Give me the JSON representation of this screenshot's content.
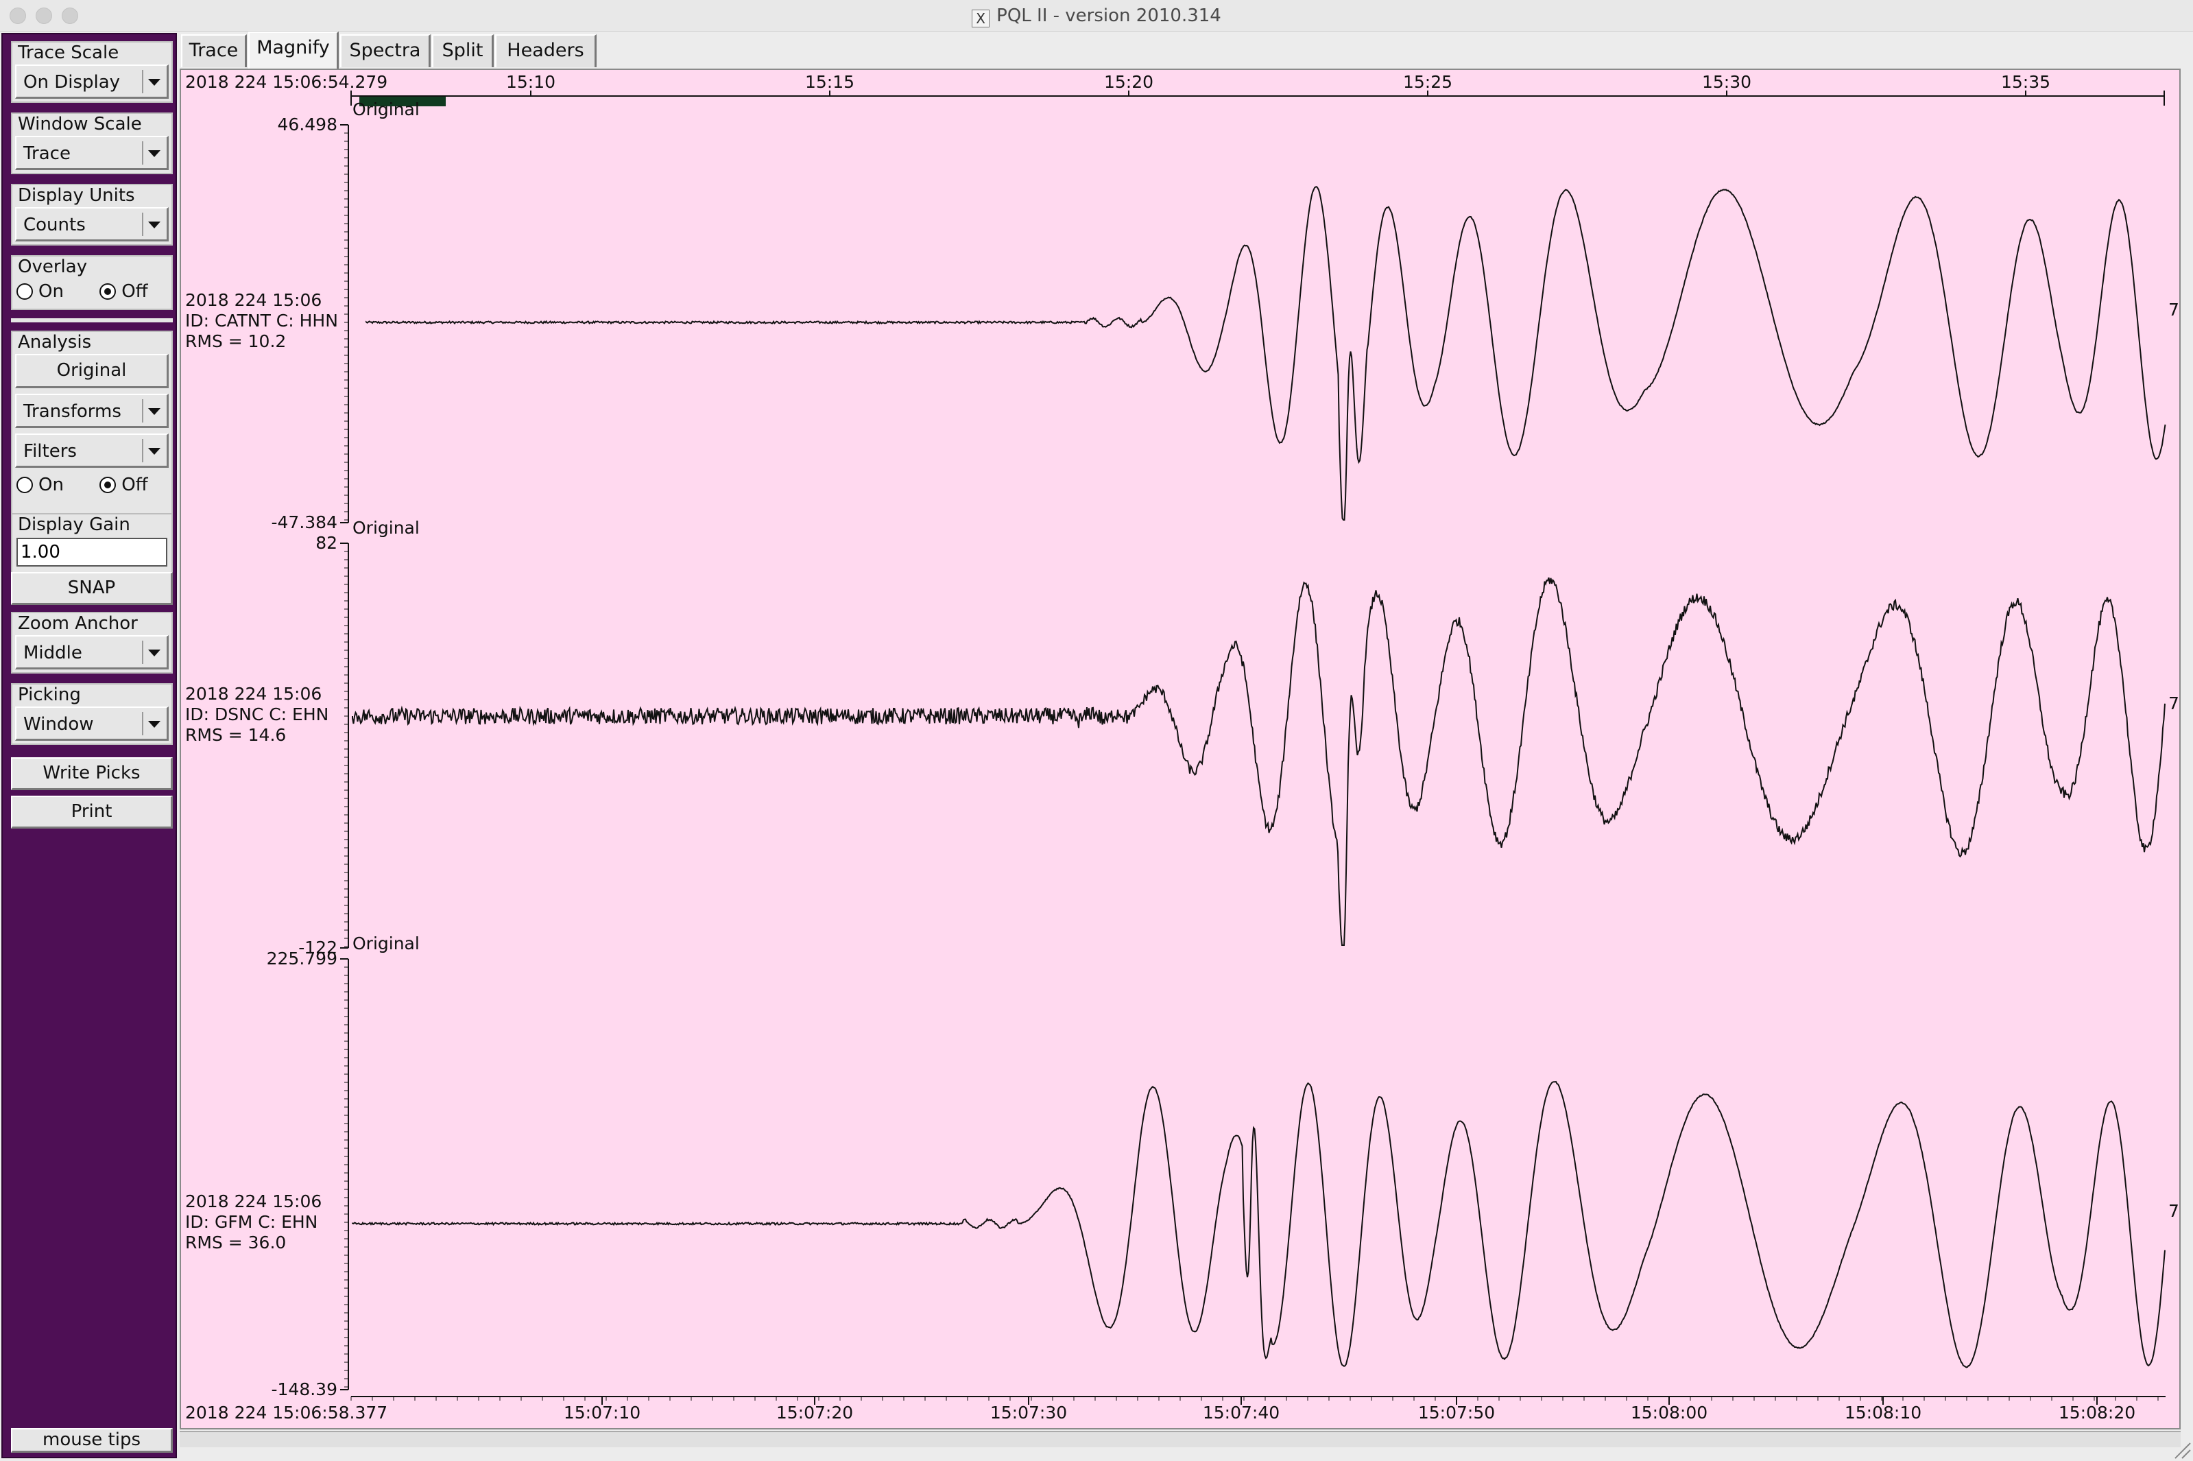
{
  "window": {
    "title": "PQL II - version 2010.314",
    "x_icon_glyph": "X"
  },
  "left_panel": {
    "trace_scale": {
      "label": "Trace Scale",
      "value": "On Display"
    },
    "window_scale": {
      "label": "Window Scale",
      "value": "Trace"
    },
    "display_units": {
      "label": "Display Units",
      "value": "Counts"
    },
    "overlay": {
      "label": "Overlay",
      "on": "On",
      "off": "Off",
      "selected": "Off"
    },
    "analysis": {
      "label": "Analysis",
      "original": "Original",
      "transforms": "Transforms",
      "filters": "Filters",
      "on": "On",
      "off": "Off",
      "selected": "Off"
    },
    "display_gain": {
      "label": "Display Gain",
      "value": "1.00"
    },
    "snap": "SNAP",
    "zoom_anchor": {
      "label": "Zoom Anchor",
      "value": "Middle"
    },
    "picking": {
      "label": "Picking",
      "value": "Window"
    },
    "write_picks": "Write Picks",
    "print": "Print",
    "mouse_tips": "mouse tips"
  },
  "tabs": [
    "Trace",
    "Magnify",
    "Spectra",
    "Split",
    "Headers"
  ],
  "active_tab": "Magnify",
  "overview_axis": {
    "start_label": "2018 224 15:06:54.279",
    "ticks": [
      "15:10",
      "15:15",
      "15:20",
      "15:25",
      "15:30",
      "15:35"
    ]
  },
  "bottom_axis": {
    "start_label": "2018 224 15:06:58.377",
    "ticks": [
      "15:07:10",
      "15:07:20",
      "15:07:30",
      "15:07:40",
      "15:07:50",
      "15:08:00",
      "15:08:10",
      "15:08:20"
    ]
  },
  "colors": {
    "plot_bg": "#ffd9ef",
    "panel_bg": "#4e0f55",
    "trace": "#111111",
    "magnify_bar": "#103a20"
  },
  "traces": [
    {
      "label": "Original",
      "ymax": "46.498",
      "ymin": "-47.384",
      "time": "2018 224 15:06",
      "id": "ID: CATNT C: HHN",
      "rms": "RMS = 10.2",
      "marker": "7"
    },
    {
      "label": "Original",
      "ymax": "82",
      "ymin": "-122",
      "time": "2018 224 15:06",
      "id": "ID: DSNC C: EHN",
      "rms": "RMS = 14.6",
      "marker": "7"
    },
    {
      "label": "Original",
      "ymax": "225.799",
      "ymin": "-148.39",
      "time": "2018 224 15:06",
      "id": "ID: GFM C: EHN",
      "rms": "RMS = 36.0",
      "marker": "7"
    }
  ]
}
